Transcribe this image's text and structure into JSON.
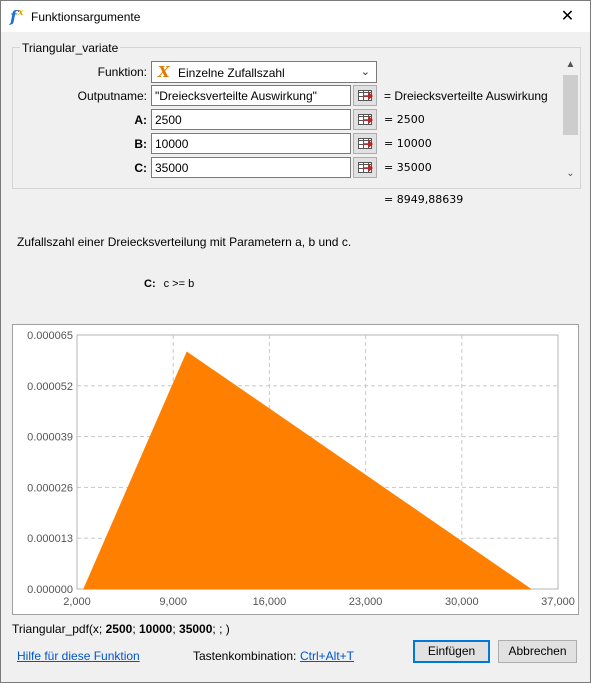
{
  "window": {
    "title": "Funktionsargumente",
    "close_glyph": "✕"
  },
  "group": {
    "legend": "Triangular_variate"
  },
  "function": {
    "label": "Funktion:",
    "value": "Einzelne Zufallszahl",
    "icon": "x-function-icon"
  },
  "args": [
    {
      "label": "Outputname:",
      "value": "\"Dreiecksverteilte Auswirkung\"",
      "result": "= Dreiecksverteilte Auswirkung"
    },
    {
      "label": "A:",
      "value": "2500",
      "result": "= 2500"
    },
    {
      "label": "B:",
      "value": "10000",
      "result": "= 10000"
    },
    {
      "label": "C:",
      "value": "35000",
      "result": "= 35000"
    }
  ],
  "result_total": "= 8949,88639",
  "description": "Zufallszahl einer Dreiecksverteilung mit Parametern a, b und c.",
  "param_help": {
    "name": "C:",
    "text": "c >= b"
  },
  "chart_data": {
    "type": "area",
    "x": [
      2500,
      10000,
      35000
    ],
    "y": [
      0,
      6.06e-05,
      0
    ],
    "xlim": [
      2000,
      37000
    ],
    "ylim": [
      0,
      6.5e-05
    ],
    "x_ticks": [
      "2,000",
      "9,000",
      "16,000",
      "23,000",
      "30,000",
      "37,000"
    ],
    "y_ticks": [
      "0.000000",
      "0.000013",
      "0.000026",
      "0.000039",
      "0.000052",
      "0.000065"
    ],
    "grid": true,
    "color": "#ff8000"
  },
  "formula": {
    "prefix": "Triangular_pdf(x; ",
    "a": "2500",
    "b": "10000",
    "c": "35000",
    "suffix": "; ; )"
  },
  "footer": {
    "help_link": "Hilfe für diese Funktion",
    "shortcut_label": "Tastenkombination:",
    "shortcut_value": "Ctrl+Alt+T",
    "insert": "Einfügen",
    "cancel": "Abbrechen"
  }
}
